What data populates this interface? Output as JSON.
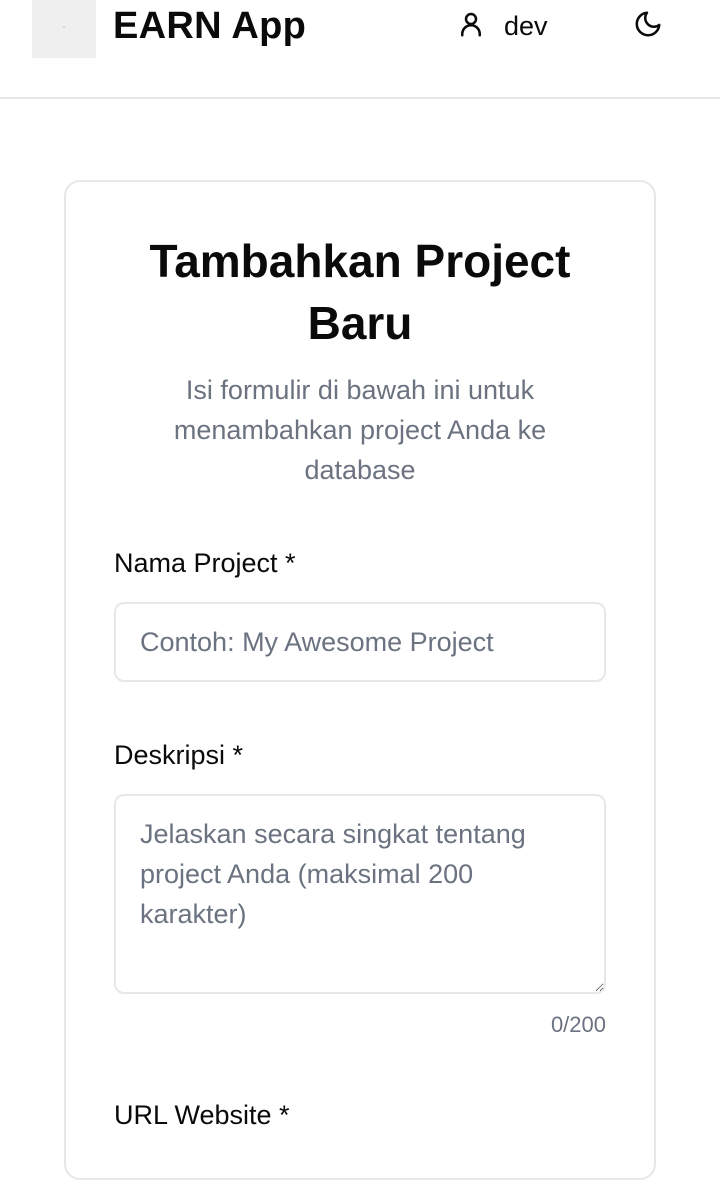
{
  "header": {
    "app_title": "EARN App",
    "user_name": "dev",
    "icons": {
      "user": "user-icon",
      "theme": "moon-icon"
    }
  },
  "form": {
    "title": "Tambahkan Project Baru",
    "subtitle": "Isi formulir di bawah ini untuk menambahkan project Anda ke database",
    "fields": {
      "name": {
        "label": "Nama Project *",
        "value": "",
        "placeholder": "Contoh: My Awesome Project"
      },
      "description": {
        "label": "Deskripsi *",
        "value": "",
        "placeholder": "Jelaskan secara singkat tentang project Anda (maksimal 200 karakter)",
        "counter": "0/200"
      },
      "url": {
        "label": "URL Website *"
      }
    }
  },
  "colors": {
    "text": "#0a0a0a",
    "muted": "#6b7280",
    "border": "#e5e7eb",
    "background": "#ffffff"
  }
}
